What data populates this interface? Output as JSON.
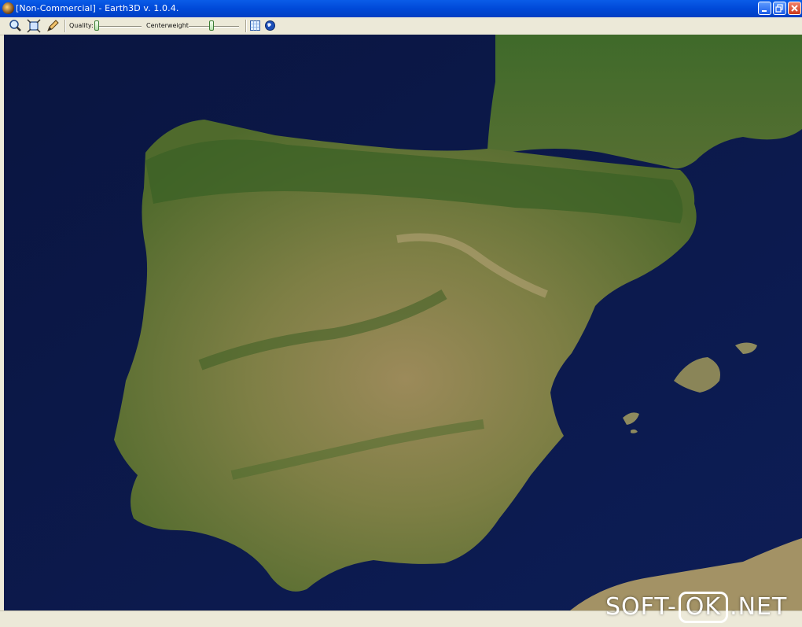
{
  "window": {
    "title": "[Non-Commercial] - Earth3D v. 1.0.4.",
    "minimize_icon": "minimize-icon",
    "restore_icon": "restore-icon",
    "close_icon": "close-icon"
  },
  "toolbar": {
    "tools": [
      "zoom-in-icon",
      "fullscreen-icon",
      "pencil-icon"
    ],
    "quality_label": "Quality:",
    "quality_value": 0.0,
    "centerweight_label": "Centerweight",
    "centerweight_value": 0.45,
    "extra_tools": [
      "grid-icon",
      "globe-icon"
    ]
  },
  "watermark": {
    "prefix": "SOFT-",
    "boxed": "OK",
    "suffix": ".NET"
  },
  "colors": {
    "ocean": "#0b1848",
    "land": "#6b7a3a",
    "titlebar": "#0049d8"
  }
}
